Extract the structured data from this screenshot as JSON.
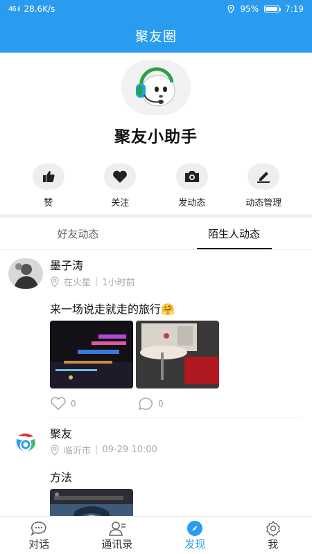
{
  "status": {
    "network": "28.6K/s",
    "battery": "95%",
    "time": "7:19",
    "battery_level": 0.95,
    "signal": "46 ıl"
  },
  "header": {
    "title": "聚友圈"
  },
  "profile": {
    "name": "聚友小助手"
  },
  "actions": [
    {
      "label": "赞",
      "icon": "thumbs-up-icon"
    },
    {
      "label": "关注",
      "icon": "heart-icon"
    },
    {
      "label": "发动态",
      "icon": "camera-icon"
    },
    {
      "label": "动态管理",
      "icon": "edit-icon"
    }
  ],
  "tabs": [
    {
      "label": "好友动态",
      "active": false
    },
    {
      "label": "陌生人动态",
      "active": true
    }
  ],
  "posts": [
    {
      "user": "墨子涛",
      "location": "在火星",
      "time": "1小时前",
      "text": "来一场说走就走的旅行🤗",
      "likes": "0",
      "comments": "0"
    },
    {
      "user": "聚友",
      "location": "临沂市",
      "time": "09-29 10:00",
      "text": "方法"
    }
  ],
  "nav": [
    {
      "label": "对话",
      "icon": "chat-icon",
      "active": false
    },
    {
      "label": "通讯录",
      "icon": "contacts-icon",
      "active": false
    },
    {
      "label": "发现",
      "icon": "compass-icon",
      "active": true
    },
    {
      "label": "我",
      "icon": "gear-icon",
      "active": false
    }
  ],
  "colors": {
    "primary": "#2a9cf0",
    "tab_active": "#111111",
    "meta": "#aaaaaa"
  }
}
